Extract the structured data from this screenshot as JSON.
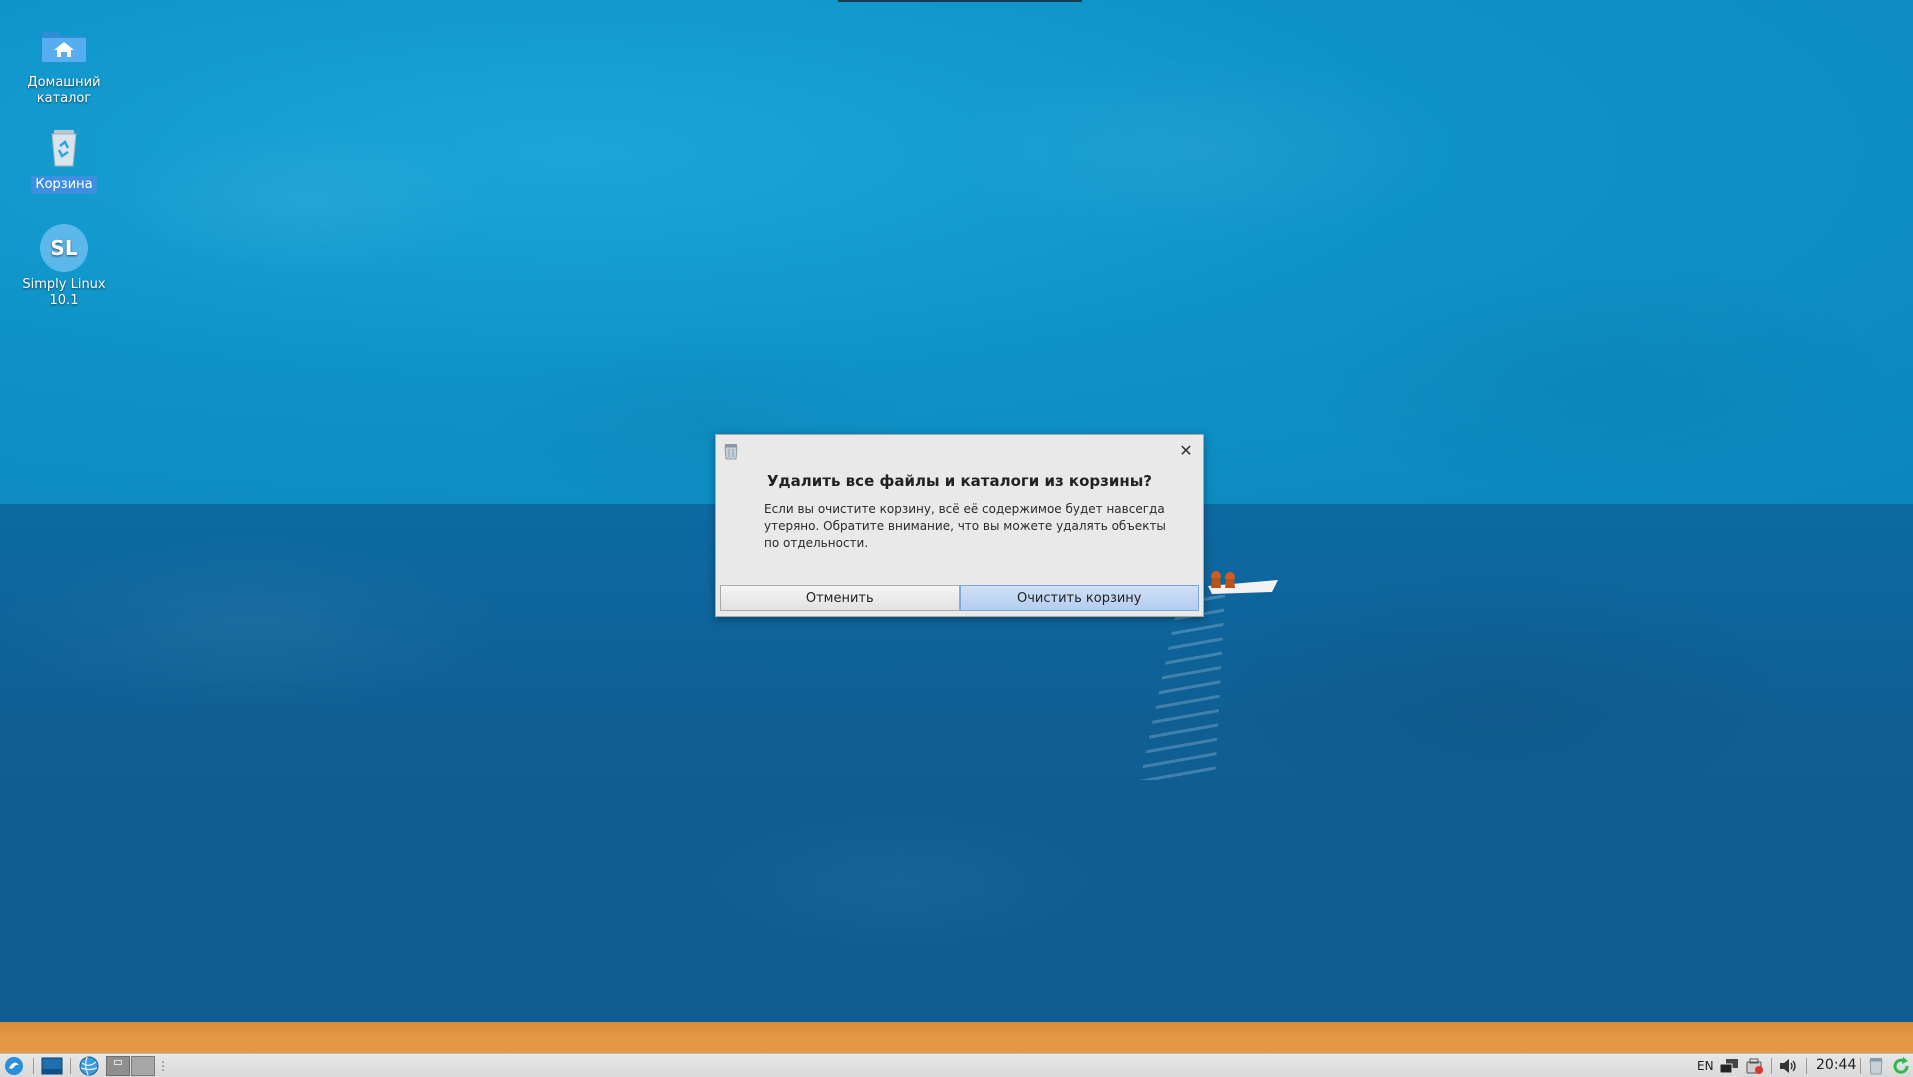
{
  "desktop": {
    "icons": [
      {
        "label_line1": "Домашний",
        "label_line2": "каталог",
        "icon": "home-folder-icon"
      },
      {
        "label": "Корзина",
        "icon": "trash-icon"
      },
      {
        "label_line1": "Simply Linux",
        "label_line2": "10.1",
        "icon": "simply-linux-icon",
        "glyph": "SL"
      }
    ]
  },
  "dialog": {
    "icon": "trash-icon",
    "close_glyph": "✕",
    "heading": "Удалить все файлы и каталоги из корзины?",
    "body": "Если вы очистите корзину, всё её содержимое будет навсегда утеряно. Обратите внимание, что вы можете удалять объекты по отдельности.",
    "cancel_label": "Отменить",
    "confirm_label": "Очистить корзину"
  },
  "taskbar": {
    "keyboard_layout": "EN",
    "clock": "20:44",
    "icons": [
      "start-menu-icon",
      "show-desktop-icon",
      "browser-icon",
      "workspace-1-icon",
      "workspace-2-icon",
      "network-icon",
      "update-icon",
      "volume-icon",
      "trash-tray-icon",
      "refresh-icon"
    ]
  },
  "colors": {
    "sky": "#0e93c8",
    "sea": "#0f5f95",
    "sand": "#e59a45",
    "selection": "#3d8fe0",
    "primary_button": "#b3cdf0"
  }
}
